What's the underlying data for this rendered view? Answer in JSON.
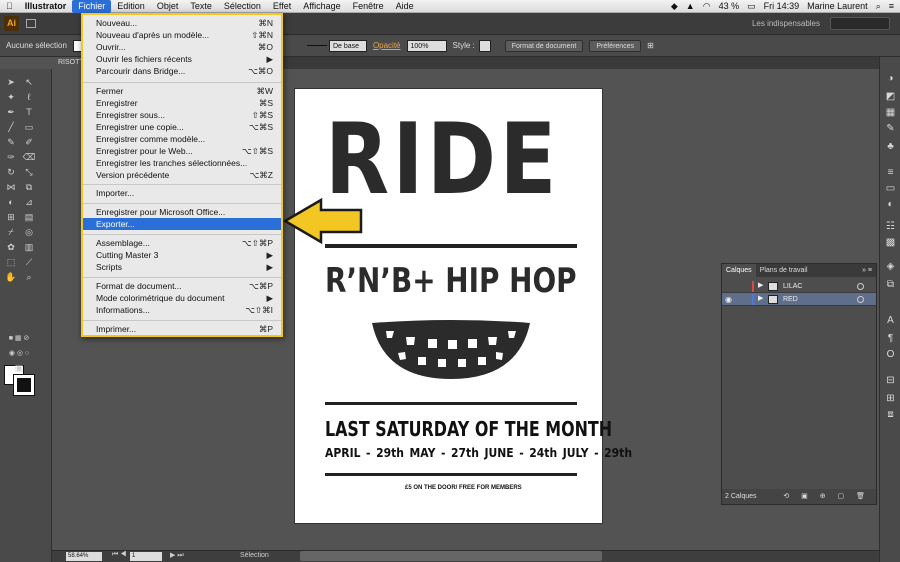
{
  "menubar": {
    "apple": "",
    "items": [
      "Illustrator",
      "Fichier",
      "Edition",
      "Objet",
      "Texte",
      "Sélection",
      "Effet",
      "Affichage",
      "Fenêtre",
      "Aide"
    ],
    "battery": "43 %",
    "clock": "Fri 14:39",
    "user": "Marine Laurent"
  },
  "app": {
    "logo": "Ai",
    "workspace": "Les indispensables"
  },
  "controlbar": {
    "selection_status": "Aucune sélection",
    "stroke_style": "De base",
    "opacity_label": "Opacité",
    "opacity_value": "100%",
    "style_label": "Style :",
    "doc_format_button": "Format de document",
    "preferences_button": "Préférences"
  },
  "document_tab": "RISOTT",
  "file_menu": {
    "items": [
      {
        "label": "Nouveau...",
        "shortcut": "⌘N"
      },
      {
        "label": "Nouveau d'après un modèle...",
        "shortcut": "⇧⌘N"
      },
      {
        "label": "Ouvrir...",
        "shortcut": "⌘O"
      },
      {
        "label": "Ouvrir les fichiers récents",
        "shortcut": "▶"
      },
      {
        "label": "Parcourir dans Bridge...",
        "shortcut": "⌥⌘O"
      },
      {
        "label": "Fermer",
        "shortcut": "⌘W"
      },
      {
        "label": "Enregistrer",
        "shortcut": "⌘S"
      },
      {
        "label": "Enregistrer sous...",
        "shortcut": "⇧⌘S"
      },
      {
        "label": "Enregistrer une copie...",
        "shortcut": "⌥⌘S"
      },
      {
        "label": "Enregistrer comme modèle...",
        "shortcut": ""
      },
      {
        "label": "Enregistrer pour le Web...",
        "shortcut": "⌥⇧⌘S"
      },
      {
        "label": "Enregistrer les tranches sélectionnées...",
        "shortcut": ""
      },
      {
        "label": "Version précédente",
        "shortcut": "⌥⌘Z"
      },
      {
        "label": "Importer...",
        "shortcut": ""
      },
      {
        "label": "Enregistrer pour Microsoft Office...",
        "shortcut": ""
      },
      {
        "label": "Exporter...",
        "shortcut": ""
      },
      {
        "label": "Assemblage...",
        "shortcut": "⌥⇧⌘P"
      },
      {
        "label": "Cutting Master 3",
        "shortcut": "▶"
      },
      {
        "label": "Scripts",
        "shortcut": "▶"
      },
      {
        "label": "Format de document...",
        "shortcut": "⌥⌘P"
      },
      {
        "label": "Mode colorimétrique du document",
        "shortcut": "▶"
      },
      {
        "label": "Informations...",
        "shortcut": "⌥⇧⌘I"
      },
      {
        "label": "Imprimer...",
        "shortcut": "⌘P"
      }
    ],
    "highlighted": "Exporter..."
  },
  "poster": {
    "title": "RIDE",
    "subtitle": "R’N’B+ HIP HOP",
    "event": "LAST SATURDAY OF THE MONTH",
    "dates": "APRIL - 29th   MAY - 27th   JUNE - 24th   JULY - 29th",
    "price": "£5 ON THE DOOR/ FREE FOR MEMBERS"
  },
  "layers_panel": {
    "tab_layers": "Calques",
    "tab_artboards": "Plans de travail",
    "layers": [
      {
        "name": "LILAC",
        "color": "#e04848"
      },
      {
        "name": "RED",
        "color": "#4a78e0"
      }
    ],
    "footer": "2 Calques"
  },
  "statusbar": {
    "zoom": "58.64%",
    "page": "1",
    "tool": "Sélection"
  },
  "colors": {
    "highlight_border": "#f2c623",
    "menu_selection": "#2a6fd8",
    "arrow_fill": "#f2c623"
  }
}
